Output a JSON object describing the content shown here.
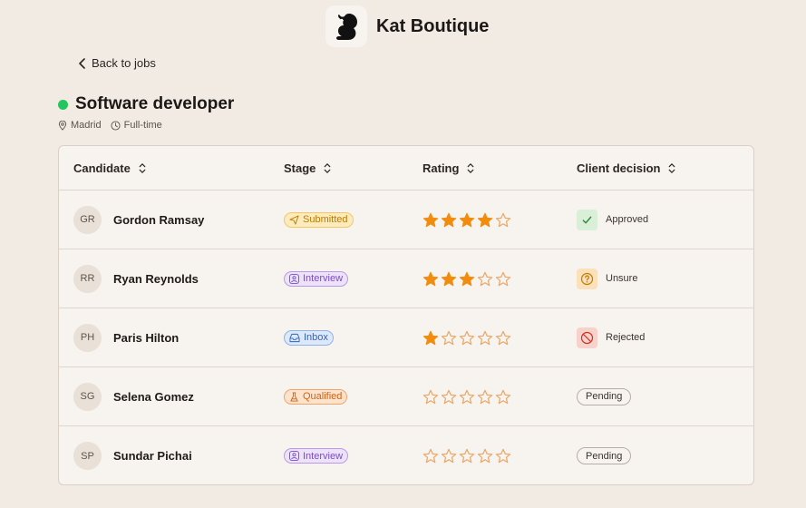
{
  "brand": {
    "name": "Kat Boutique",
    "logo_icon": "squirrel-icon"
  },
  "nav": {
    "back_label": "Back to jobs"
  },
  "job": {
    "title": "Software developer",
    "status_color": "#22c55e",
    "location": "Madrid",
    "employment_type": "Full-time"
  },
  "table": {
    "columns": [
      "Candidate",
      "Stage",
      "Rating",
      "Client decision"
    ],
    "rows": [
      {
        "initials": "GR",
        "name": "Gordon Ramsay",
        "stage": "Submitted",
        "stage_kind": "submitted",
        "rating": 4,
        "decision": "Approved",
        "decision_kind": "approved"
      },
      {
        "initials": "RR",
        "name": "Ryan Reynolds",
        "stage": "Interview",
        "stage_kind": "interview",
        "rating": 3,
        "decision": "Unsure",
        "decision_kind": "unsure"
      },
      {
        "initials": "PH",
        "name": "Paris Hilton",
        "stage": "Inbox",
        "stage_kind": "inbox",
        "rating": 1,
        "decision": "Rejected",
        "decision_kind": "rejected"
      },
      {
        "initials": "SG",
        "name": "Selena Gomez",
        "stage": "Qualified",
        "stage_kind": "qualified",
        "rating": 0,
        "decision": "Pending",
        "decision_kind": "pending"
      },
      {
        "initials": "SP",
        "name": "Sundar Pichai",
        "stage": "Interview",
        "stage_kind": "interview",
        "rating": 0,
        "decision": "Pending",
        "decision_kind": "pending"
      }
    ]
  },
  "colors": {
    "star_filled": "#f28c0f",
    "star_empty": "#e8a86a"
  }
}
